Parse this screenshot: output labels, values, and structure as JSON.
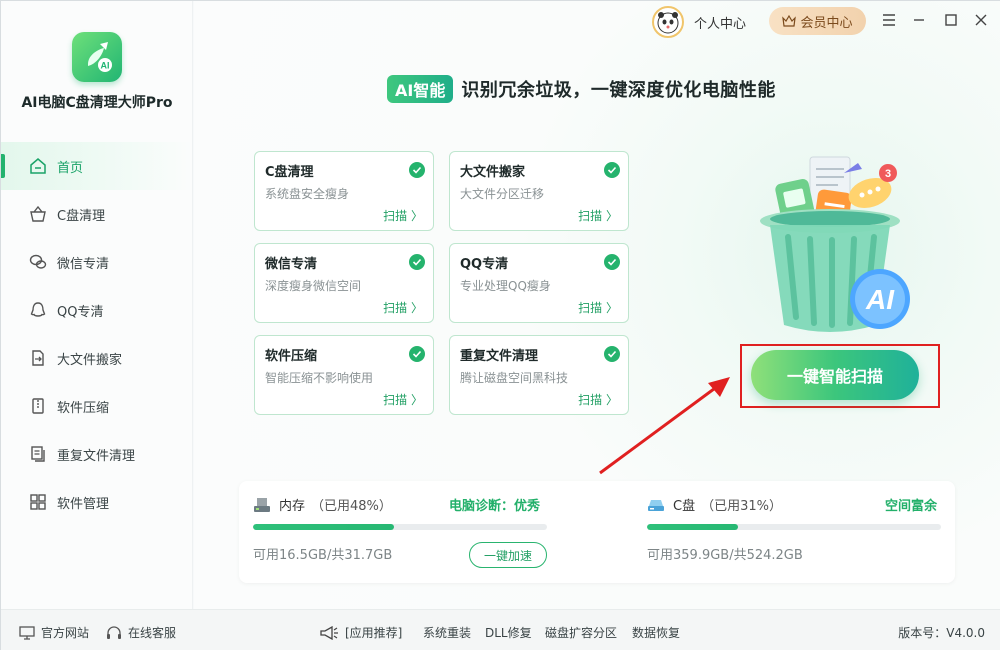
{
  "app": {
    "name": "AI电脑C盘清理大师Pro",
    "logo_badge": "AI",
    "colors": {
      "accent": "#23b26e",
      "highlight": "#e02020",
      "vip": "#f2d2ad"
    }
  },
  "titlebar": {
    "personal_center": "个人中心",
    "vip_center": "会员中心",
    "controls": [
      "skin-icon",
      "minimize-icon",
      "maximize-icon",
      "close-icon"
    ]
  },
  "sidebar": {
    "items": [
      {
        "label": "首页",
        "icon": "home-icon",
        "active": true
      },
      {
        "label": "C盘清理",
        "icon": "basket-icon",
        "active": false
      },
      {
        "label": "微信专清",
        "icon": "wechat-icon",
        "active": false
      },
      {
        "label": "QQ专清",
        "icon": "qq-icon",
        "active": false
      },
      {
        "label": "大文件搬家",
        "icon": "file-move-icon",
        "active": false
      },
      {
        "label": "软件压缩",
        "icon": "compress-icon",
        "active": false
      },
      {
        "label": "重复文件清理",
        "icon": "duplicate-file-icon",
        "active": false
      },
      {
        "label": "软件管理",
        "icon": "apps-icon",
        "active": false
      }
    ]
  },
  "headline": {
    "badge": "AI智能",
    "text": "识别冗余垃圾，一键深度优化电脑性能"
  },
  "cards": [
    {
      "title": "C盘清理",
      "desc": "系统盘安全瘦身",
      "action": "扫描 〉"
    },
    {
      "title": "大文件搬家",
      "desc": "大文件分区迁移",
      "action": "扫描 〉"
    },
    {
      "title": "微信专清",
      "desc": "深度瘦身微信空间",
      "action": "扫描 〉"
    },
    {
      "title": "QQ专清",
      "desc": "专业处理QQ瘦身",
      "action": "扫描 〉"
    },
    {
      "title": "软件压缩",
      "desc": "智能压缩不影响使用",
      "action": "扫描 〉"
    },
    {
      "title": "重复文件清理",
      "desc": "腾让磁盘空间黑科技",
      "action": "扫描 〉"
    }
  ],
  "illustration": {
    "badge_count": "3",
    "ai_label": "AI"
  },
  "scan_button": "一键智能扫描",
  "memory": {
    "label": "内存",
    "usage": "（已用48%）",
    "used_fraction": 0.48,
    "status": "电脑诊断：优秀",
    "available": "可用16.5GB/共31.7GB",
    "action": "一键加速"
  },
  "disk": {
    "label": "C盘",
    "usage": "（已用31%）",
    "used_fraction": 0.31,
    "status": "空间富余",
    "available": "可用359.9GB/共524.2GB"
  },
  "footer": {
    "website": "官方网站",
    "support": "在线客服",
    "recommend": "[应用推荐]",
    "links": [
      "系统重装",
      "DLL修复",
      "磁盘扩容分区",
      "数据恢复"
    ],
    "version": "版本号：V4.0.0"
  }
}
